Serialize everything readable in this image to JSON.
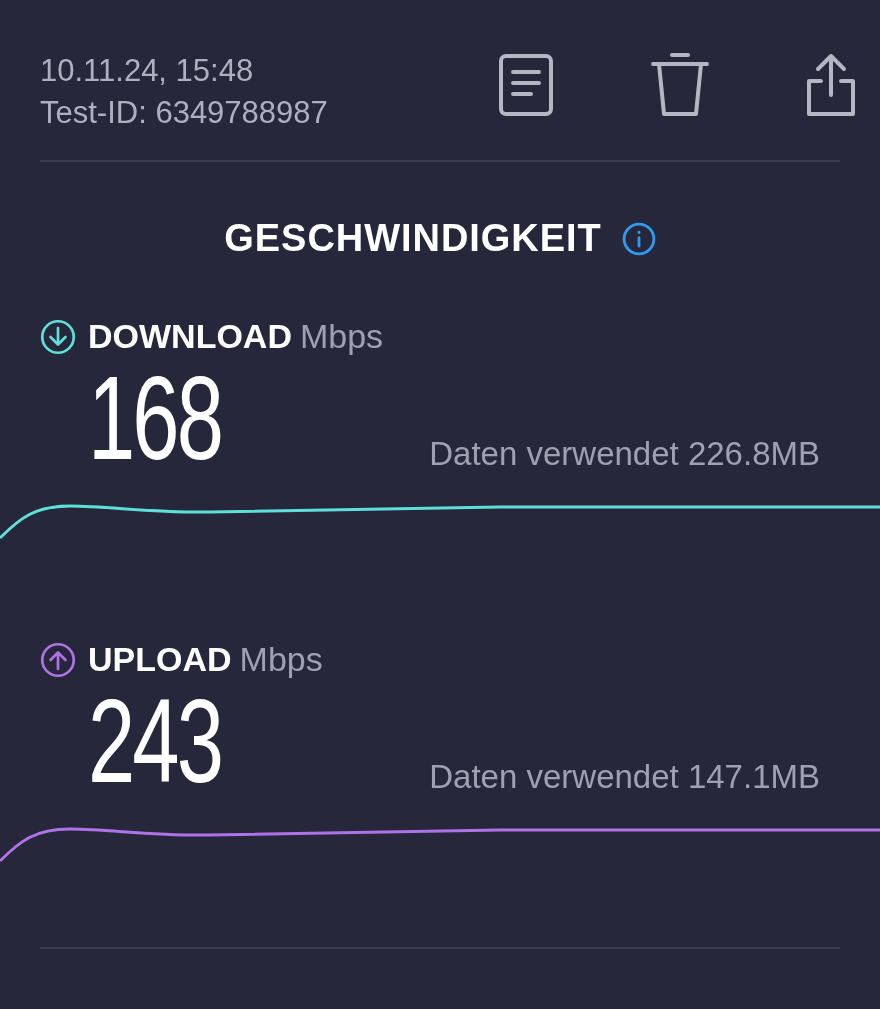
{
  "header": {
    "date": "10.11.24, 15:48",
    "test_id": "Test-ID: 6349788987"
  },
  "title": "GESCHWINDIGKEIT",
  "tests": [
    {
      "kind": "download",
      "label": "DOWNLOAD",
      "unit": "Mbps",
      "value": "168",
      "data_used": "Daten verwendet 226.8MB",
      "color": "#5ee0d8"
    },
    {
      "kind": "upload",
      "label": "UPLOAD",
      "unit": "Mbps",
      "value": "243",
      "data_used": "Daten verwendet 147.1MB",
      "color": "#b072e8"
    }
  ]
}
